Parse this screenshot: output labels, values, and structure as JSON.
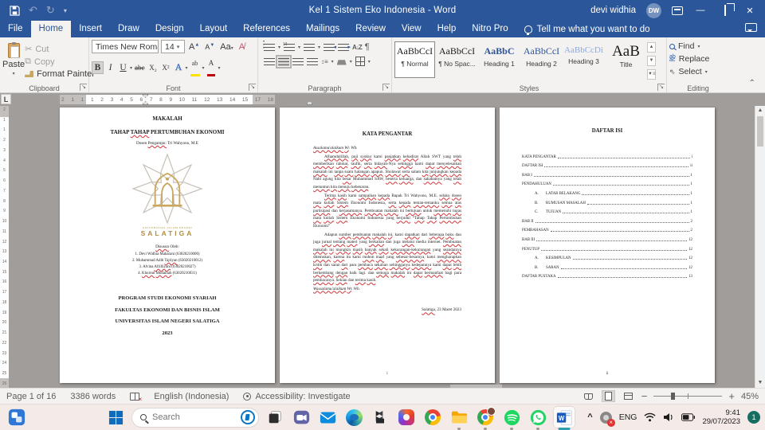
{
  "colors": {
    "accent": "#2b579a",
    "squiggle": "#d13438",
    "logo_gold": "#b08d3e",
    "badge_teal": "#156e5f",
    "word_blue": "#185abd"
  },
  "titlebar": {
    "title": "Kel 1 Sistem Eko Indonesia  -  Word",
    "user_name": "devi widhia",
    "avatar_initials": "DW"
  },
  "ribbon_tabs": [
    "File",
    "Home",
    "Insert",
    "Draw",
    "Design",
    "Layout",
    "References",
    "Mailings",
    "Review",
    "View",
    "Help",
    "Nitro Pro"
  ],
  "active_tab": "Home",
  "tell_me": "Tell me what you want to do",
  "ribbon": {
    "clipboard": {
      "label": "Clipboard",
      "paste": "Paste",
      "cut": "Cut",
      "copy": "Copy",
      "format_painter": "Format Painter"
    },
    "font": {
      "label": "Font",
      "font_name": "Times New Roma",
      "font_size": "14",
      "grow": "A",
      "shrink": "A",
      "change_case": "Aa",
      "bold": "B",
      "italic": "I",
      "underline": "U",
      "strikethrough": "abc",
      "subscript": "X₂",
      "superscript": "X²",
      "text_effects": "A",
      "font_color": "A"
    },
    "paragraph": {
      "label": "Paragraph",
      "sort": "A↓",
      "pilcrow": "¶"
    },
    "styles": {
      "label": "Styles",
      "items": [
        {
          "preview": "AaBbCcI",
          "name": "¶ Normal",
          "selected": true
        },
        {
          "preview": "AaBbCcI",
          "name": "¶ No Spac...",
          "selected": false
        },
        {
          "preview": "AaBbC",
          "name": "Heading 1",
          "selected": false
        },
        {
          "preview": "AaBbCcI",
          "name": "Heading 2",
          "selected": false
        },
        {
          "preview": "AaBbCcDi",
          "name": "Heading 3",
          "selected": false
        },
        {
          "preview": "AaB",
          "name": "Title",
          "selected": false
        }
      ]
    },
    "editing": {
      "label": "Editing",
      "find": "Find",
      "replace": "Replace",
      "select": "Select"
    }
  },
  "ruler": {
    "h_numbers": [
      "2",
      "1",
      "1",
      "1",
      "2",
      "3",
      "4",
      "5",
      "6",
      "7",
      "8",
      "9",
      "10",
      "11",
      "12",
      "13",
      "14",
      "15",
      "17",
      "18"
    ],
    "v_numbers": [
      "2",
      "1",
      "1",
      "2",
      "3",
      "4",
      "5",
      "6",
      "7",
      "8",
      "9",
      "10",
      "11",
      "12",
      "13",
      "14",
      "15",
      "16",
      "17",
      "18",
      "19",
      "20",
      "21",
      "22",
      "23",
      "24",
      "25",
      "26"
    ]
  },
  "pages": {
    "cover": {
      "line1": "MAKALAH",
      "line2": "TAHAP [TAHAP] PERTUMBUHAN EKONOMI",
      "line3": "Dosen [Pengampu:] Tri Wahyono, M.E",
      "logo_line1": "UNIVERSITAS ISLAM NEGERI",
      "logo_line2": "SALATIGA",
      "disusun": "[Disusun] Oleh:",
      "authors": [
        "Devi Widhia Maharani (63020210006)",
        "Muhammad Adib [Tajriyan] (63020210012)",
        "Alvina [Afrilliyani] (63020210027)",
        "[Khoirun] [Mudainah] (63020210031)"
      ],
      "footer": [
        "PROGRAM STUDI EKONOMI SYARIAH",
        "FAKULTAS EKONOMI DAN BISNIS ISLAM",
        "UNIVERSITAS ISLAM NEGERI SALATIGA",
        "2023"
      ]
    },
    "kata_pengantar": {
      "title": "KATA PENGANTAR",
      "paragraphs": [
        {
          "text": "[Assalamu'alaikum] [Wr]. Wb.",
          "italic": true,
          "indent": false
        },
        {
          "text": "[Alhamdulillah], [puji] [syukur] kami [panjatkan] [kehadirat] Allah SWT yang [telah] [memberikan] [rahmat], [taufik], [serta] [hidayah]-Nya [sehingga] kami [dapat] [menyelesaikan] [makalah] ini [tanpa] [suatu] [halangan] [apapun]. [Sholawat] [serta] salam [kita] [junjungkan] [kepada] Nabi agung kita [besar] Muhammad SAW, [beserta] [keluarga], dan [sahabatnya] yang [telah] [menuntun] [kita] [menuju] [kebenaran].",
          "italic": false,
          "indent": true
        },
        {
          "text": "[Terima] [kasih] kami [sampaikan] [kepada] Bapak Tri Wahyono, M.E. [selaku] [dosen] [mata] [kuliah] [Sistem] Ekonomi Indonesia, [serta] [kepada] [teman-temanku] [semua] [atas] [partisipasi] dan [kerjasamanya]. [Pembuatan] [makalah] ini [bertujuan] untuk [memenuhi] [tugas] [mata] [kuliah] [Sistem] Ekonomi Indonesia yang [berjudul] “[Tahap] [Tahap] [Pertumbuhan] Ekonomi”",
          "italic": false,
          "indent": true
        },
        {
          "text": "Adapun [sumber] [pembuatan] [makalah] [ini], kami [dapatkan] dari [beberapa] [buku] dan juga [jurnal] [tentang] [materi] yang [berkaitan] dan juga [melalui] media internet. [Pembuatan] [makalah] [ini] [mungkin] [masih] [banyak] [sekali] [kekurangan-kekurangan] yang [seandainya] [ditemukan], [karena] itu kami [mohon] [maaf] yang [sebesar-besarnya], kami [mengharapkan] [kritik] dan saran [dari] para [pembaca] [sekalian] [sehingganya] [kedepannya] kami [dapat] [lebih] [berkembang] [dengan] baik lagi. dan [semoga] [makalah] ini [dapat] [bermanfaat] bagi para [pembacanya]. [Sekian] dan [terima] [kasih].",
          "italic": false,
          "indent": true
        },
        {
          "text": "[Wassalamu'alaikum] [Wr]. Wb.",
          "italic": true,
          "indent": false
        }
      ],
      "date_line": "[Salatiga], 23 Maret 2023",
      "page_number": "i"
    },
    "daftar_isi": {
      "title": "DAFTAR ISI",
      "items": [
        {
          "prefix": "",
          "label": "KATA PENGANTAR",
          "page": "i"
        },
        {
          "prefix": "",
          "label": "DAFTAR ISI",
          "page": "ii"
        },
        {
          "prefix": "",
          "label": "BAB I",
          "page": "1"
        },
        {
          "prefix": "",
          "label": "PENDAHULUAN",
          "page": "1"
        },
        {
          "prefix": "A.",
          "label": "LATAR BELAKANG",
          "page": "1"
        },
        {
          "prefix": "B.",
          "label": "RUMUSAN MASALAH",
          "page": "1"
        },
        {
          "prefix": "C.",
          "label": "TUJUAN",
          "page": "1"
        },
        {
          "prefix": "",
          "label": "BAB II",
          "page": "2"
        },
        {
          "prefix": "",
          "label": "PEMBAHASAN",
          "page": "2"
        },
        {
          "prefix": "",
          "label": "BAB III",
          "page": "12"
        },
        {
          "prefix": "",
          "label": "PENUTUP",
          "page": "12"
        },
        {
          "prefix": "A.",
          "label": "KESIMPULAN",
          "page": "12"
        },
        {
          "prefix": "B.",
          "label": "SARAN",
          "page": "12"
        },
        {
          "prefix": "",
          "label": "DAFTAR PUSTAKA",
          "page": "13"
        }
      ],
      "page_number": "ii"
    }
  },
  "statusbar": {
    "page": "Page 1 of 16",
    "words": "3386 words",
    "language": "English (Indonesia)",
    "accessibility": "Accessibility: Investigate",
    "zoom": "45%"
  },
  "taskbar": {
    "search_placeholder": "Search",
    "language": "ENG",
    "time": "9:41",
    "date": "29/07/2023",
    "badge": "1"
  }
}
